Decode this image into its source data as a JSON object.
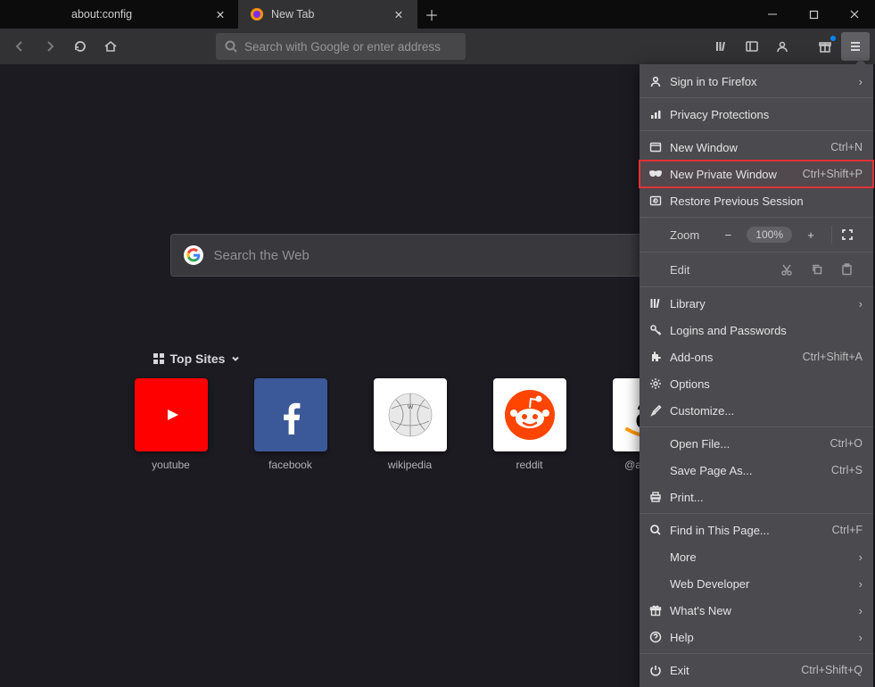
{
  "tabs": [
    {
      "label": "about:config",
      "active": false,
      "hasIcon": false
    },
    {
      "label": "New Tab",
      "active": true,
      "hasIcon": true
    }
  ],
  "addressbar": {
    "placeholder": "Search with Google or enter address"
  },
  "search": {
    "placeholder": "Search the Web"
  },
  "topsites_header": "Top Sites",
  "sites": [
    {
      "label": "youtube"
    },
    {
      "label": "facebook"
    },
    {
      "label": "wikipedia"
    },
    {
      "label": "reddit"
    },
    {
      "label": "@amazon"
    }
  ],
  "menu": {
    "signin": "Sign in to Firefox",
    "privacy": "Privacy Protections",
    "new_window": {
      "label": "New Window",
      "shortcut": "Ctrl+N"
    },
    "new_private": {
      "label": "New Private Window",
      "shortcut": "Ctrl+Shift+P"
    },
    "restore": "Restore Previous Session",
    "zoom_label": "Zoom",
    "zoom_value": "100%",
    "edit_label": "Edit",
    "library": "Library",
    "logins": "Logins and Passwords",
    "addons": {
      "label": "Add-ons",
      "shortcut": "Ctrl+Shift+A"
    },
    "options": "Options",
    "customize": "Customize...",
    "open_file": {
      "label": "Open File...",
      "shortcut": "Ctrl+O"
    },
    "save_page": {
      "label": "Save Page As...",
      "shortcut": "Ctrl+S"
    },
    "print": "Print...",
    "find": {
      "label": "Find in This Page...",
      "shortcut": "Ctrl+F"
    },
    "more": "More",
    "webdev": "Web Developer",
    "whatsnew": "What's New",
    "help": "Help",
    "exit": {
      "label": "Exit",
      "shortcut": "Ctrl+Shift+Q"
    }
  }
}
